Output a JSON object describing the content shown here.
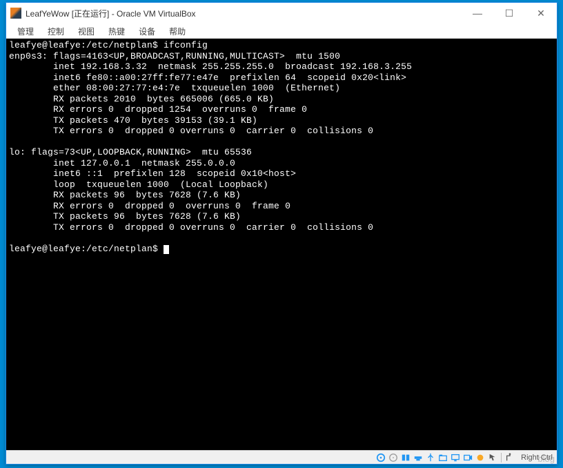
{
  "window": {
    "title": "LeafYeWow [正在运行] - Oracle VM VirtualBox",
    "minimize": "—",
    "maximize": "☐",
    "close": "✕"
  },
  "menu": {
    "items": [
      "管理",
      "控制",
      "视图",
      "热键",
      "设备",
      "帮助"
    ]
  },
  "terminal": {
    "prompt1": "leafye@leafye:/etc/netplan$ ifconfig",
    "enp0s3_head": "enp0s3: flags=4163<UP,BROADCAST,RUNNING,MULTICAST>  mtu 1500",
    "enp_inet": "        inet 192.168.3.32  netmask 255.255.255.0  broadcast 192.168.3.255",
    "enp_inet6": "        inet6 fe80::a00:27ff:fe77:e47e  prefixlen 64  scopeid 0x20<link>",
    "enp_ether": "        ether 08:00:27:77:e4:7e  txqueuelen 1000  (Ethernet)",
    "enp_rxp": "        RX packets 2010  bytes 665006 (665.0 KB)",
    "enp_rxe": "        RX errors 0  dropped 1254  overruns 0  frame 0",
    "enp_txp": "        TX packets 470  bytes 39153 (39.1 KB)",
    "enp_txe": "        TX errors 0  dropped 0 overruns 0  carrier 0  collisions 0",
    "blank1": "",
    "lo_head": "lo: flags=73<UP,LOOPBACK,RUNNING>  mtu 65536",
    "lo_inet": "        inet 127.0.0.1  netmask 255.0.0.0",
    "lo_inet6": "        inet6 ::1  prefixlen 128  scopeid 0x10<host>",
    "lo_loop": "        loop  txqueuelen 1000  (Local Loopback)",
    "lo_rxp": "        RX packets 96  bytes 7628 (7.6 KB)",
    "lo_rxe": "        RX errors 0  dropped 0  overruns 0  frame 0",
    "lo_txp": "        TX packets 96  bytes 7628 (7.6 KB)",
    "lo_txe": "        TX errors 0  dropped 0 overruns 0  carrier 0  collisions 0",
    "blank2": "",
    "prompt2": "leafye@leafye:/etc/netplan$ "
  },
  "statusbar": {
    "host_key": "Right Ctrl"
  },
  "watermark": "blog"
}
